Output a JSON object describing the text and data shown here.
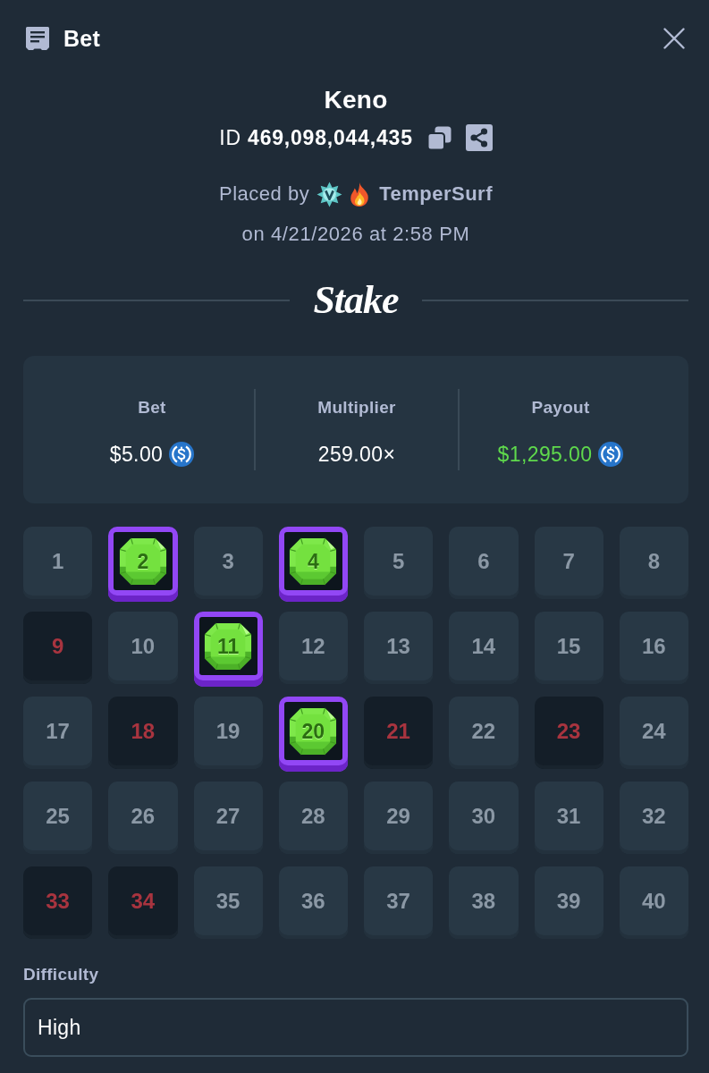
{
  "header": {
    "title": "Bet"
  },
  "game": {
    "name": "Keno",
    "bet_id": "ID **469,098,044,435**",
    "placed_by": "Placed by",
    "user": "TemperSurf",
    "date": "on 4/21/2026 at 2:58 PM"
  },
  "logo": "Stake",
  "stats": [
    {
      "label": "Bet",
      "value": "$5.00",
      "coin": true,
      "color": "#ffffff"
    },
    {
      "label": "Multiplier",
      "value": "259.00×",
      "coin": false,
      "color": "#ffffff"
    },
    {
      "label": "Payout",
      "value": "$1,295.00",
      "coin": true,
      "color": "#5fd94c"
    }
  ],
  "tiles": [
    {
      "number": "1",
      "picked": false,
      "drawn": false
    },
    {
      "number": "2",
      "picked": true,
      "drawn": true
    },
    {
      "number": "3",
      "picked": false,
      "drawn": false
    },
    {
      "number": "4",
      "picked": true,
      "drawn": true
    },
    {
      "number": "5",
      "picked": false,
      "drawn": false
    },
    {
      "number": "6",
      "picked": false,
      "drawn": false
    },
    {
      "number": "7",
      "picked": false,
      "drawn": false
    },
    {
      "number": "8",
      "picked": false,
      "drawn": false
    },
    {
      "number": "9",
      "picked": false,
      "drawn": true
    },
    {
      "number": "10",
      "picked": false,
      "drawn": false
    },
    {
      "number": "11",
      "picked": true,
      "drawn": true
    },
    {
      "number": "12",
      "picked": false,
      "drawn": false
    },
    {
      "number": "13",
      "picked": false,
      "drawn": false
    },
    {
      "number": "14",
      "picked": false,
      "drawn": false
    },
    {
      "number": "15",
      "picked": false,
      "drawn": false
    },
    {
      "number": "16",
      "picked": false,
      "drawn": false
    },
    {
      "number": "17",
      "picked": false,
      "drawn": false
    },
    {
      "number": "18",
      "picked": false,
      "drawn": true
    },
    {
      "number": "19",
      "picked": false,
      "drawn": false
    },
    {
      "number": "20",
      "picked": true,
      "drawn": true
    },
    {
      "number": "21",
      "picked": false,
      "drawn": true
    },
    {
      "number": "22",
      "picked": false,
      "drawn": false
    },
    {
      "number": "23",
      "picked": false,
      "drawn": true
    },
    {
      "number": "24",
      "picked": false,
      "drawn": false
    },
    {
      "number": "25",
      "picked": false,
      "drawn": false
    },
    {
      "number": "26",
      "picked": false,
      "drawn": false
    },
    {
      "number": "27",
      "picked": false,
      "drawn": false
    },
    {
      "number": "28",
      "picked": false,
      "drawn": false
    },
    {
      "number": "29",
      "picked": false,
      "drawn": false
    },
    {
      "number": "30",
      "picked": false,
      "drawn": false
    },
    {
      "number": "31",
      "picked": false,
      "drawn": false
    },
    {
      "number": "32",
      "picked": false,
      "drawn": false
    },
    {
      "number": "33",
      "picked": false,
      "drawn": true
    },
    {
      "number": "34",
      "picked": false,
      "drawn": true
    },
    {
      "number": "35",
      "picked": false,
      "drawn": false
    },
    {
      "number": "36",
      "picked": false,
      "drawn": false
    },
    {
      "number": "37",
      "picked": false,
      "drawn": false
    },
    {
      "number": "38",
      "picked": false,
      "drawn": false
    },
    {
      "number": "39",
      "picked": false,
      "drawn": false
    },
    {
      "number": "40",
      "picked": false,
      "drawn": false
    }
  ],
  "difficulty": {
    "label": "Difficulty",
    "value": "High"
  }
}
